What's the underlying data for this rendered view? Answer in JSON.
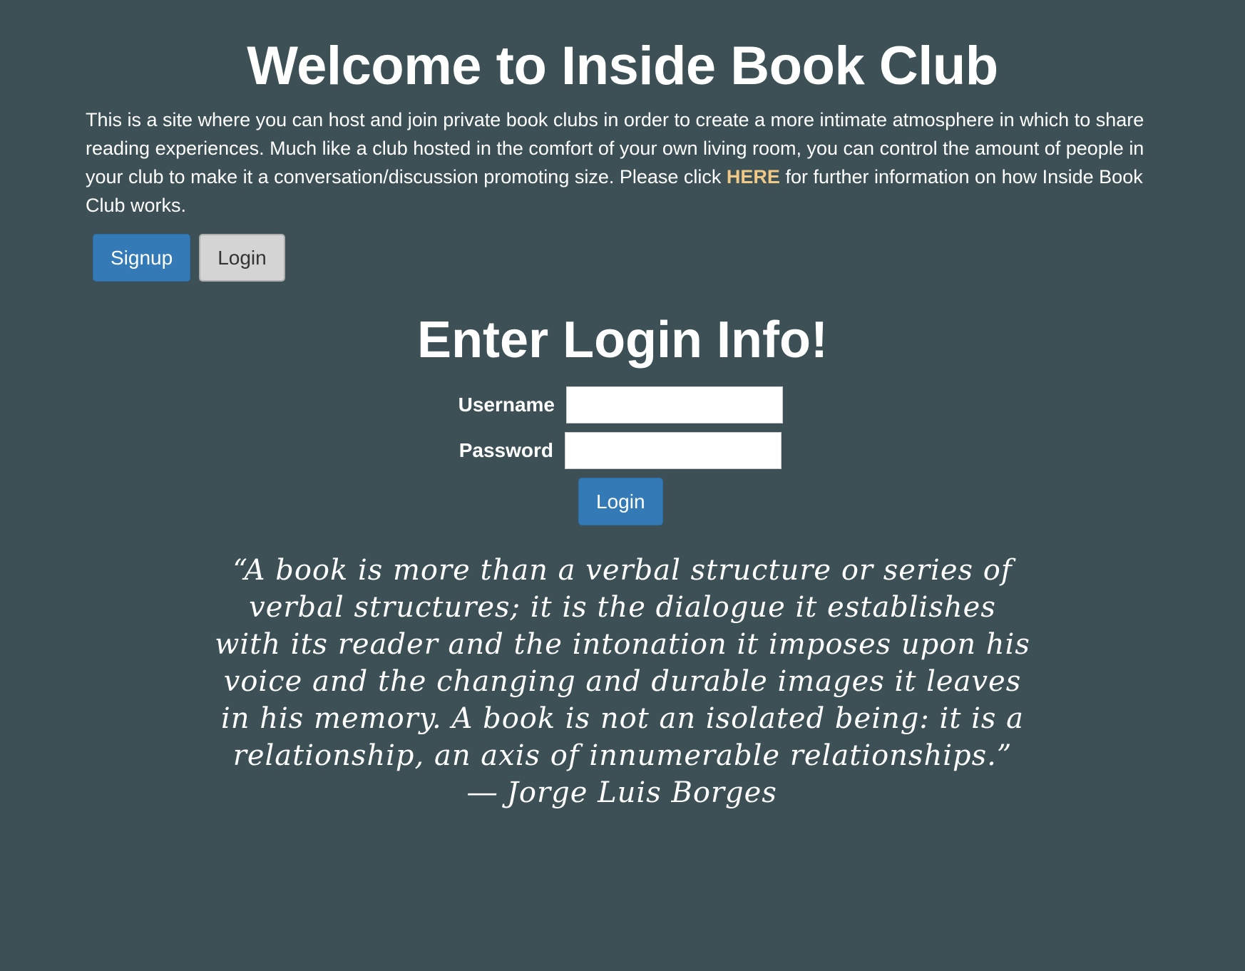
{
  "header": {
    "title": "Welcome to Inside Book Club"
  },
  "intro": {
    "text_before": "This is a site where you can host and join private book clubs in order to create a more intimate atmosphere in which to share reading experiences. Much like a club hosted in the comfort of your own living room, you can control the amount of people in your club to make it a conversation/discussion promoting size. Please click ",
    "link_label": "HERE",
    "text_after": " for further information on how Inside Book Club works."
  },
  "tabs": {
    "signup_label": "Signup",
    "login_label": "Login"
  },
  "login_form": {
    "heading": "Enter Login Info!",
    "username_label": "Username",
    "username_value": "",
    "password_label": "Password",
    "password_value": "",
    "submit_label": "Login"
  },
  "quote": {
    "text": "“A book is more than a verbal structure or series of verbal structures; it is the dialogue it establishes with its reader and the intonation it imposes upon his voice and the changing and durable images it leaves in his memory. A book is not an isolated being: it is a relationship, an axis of innumerable relationships.” ― Jorge Luis Borges"
  },
  "colors": {
    "background": "#3c5056",
    "primary_button": "#337ab7",
    "link": "#f0c987"
  }
}
